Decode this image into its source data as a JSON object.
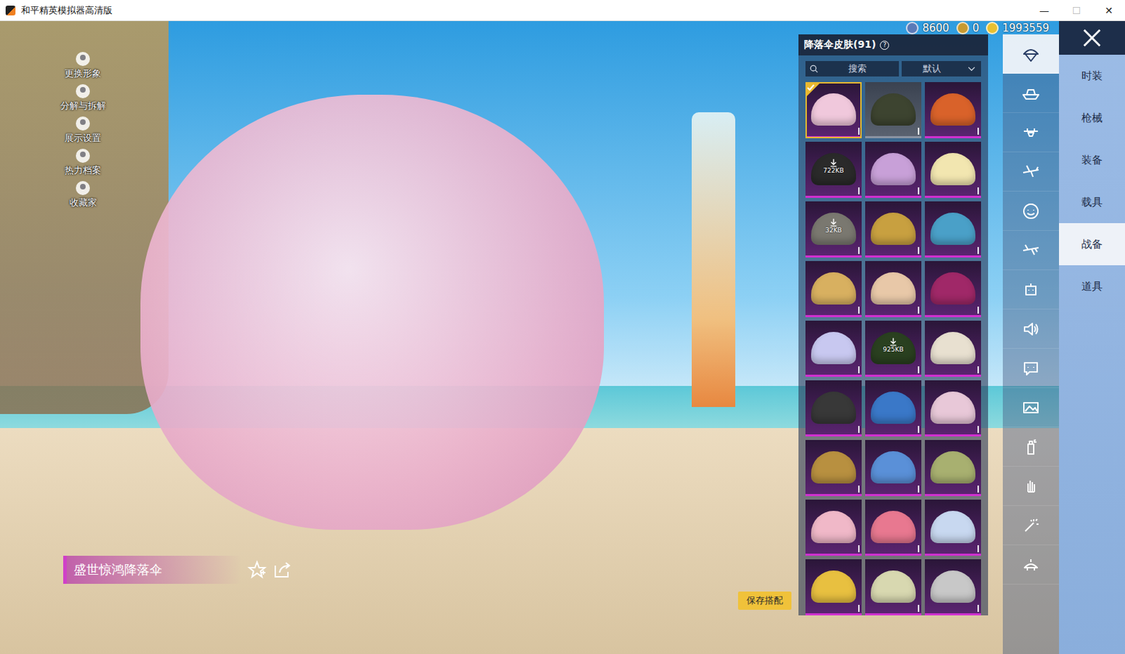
{
  "window": {
    "title": "和平精英模拟器高清版",
    "controls": [
      {
        "glyph": "—",
        "disabled": false
      },
      {
        "glyph": "☐",
        "disabled": true
      },
      {
        "glyph": "✕",
        "disabled": false
      }
    ]
  },
  "side_menu": [
    {
      "label": "更换形象"
    },
    {
      "label": "分解与拆解"
    },
    {
      "label": "展示设置"
    },
    {
      "label": "热力档案"
    },
    {
      "label": "收藏家"
    }
  ],
  "item_name": "盛世惊鸿降落伞",
  "save_button": "保存搭配",
  "currencies": [
    {
      "amount": "8600",
      "color": "#5a7ab8"
    },
    {
      "amount": "0",
      "color": "#c89a30"
    },
    {
      "amount": "1993559",
      "color": "#e8c030"
    }
  ],
  "panel": {
    "title": "降落伞皮肤(91)",
    "help": "?",
    "search_placeholder": "搜索",
    "sort": "默认"
  },
  "skins": [
    {
      "selected": true,
      "rarity": "epic",
      "color": "#f0c8dc"
    },
    {
      "selected": false,
      "rarity": "common",
      "color": "#3d4430"
    },
    {
      "selected": false,
      "rarity": "epic",
      "color": "#d9622a"
    },
    {
      "selected": false,
      "rarity": "epic",
      "color": "#2a2a2a",
      "download": "722KB"
    },
    {
      "selected": false,
      "rarity": "epic",
      "color": "#c8a0d8"
    },
    {
      "selected": false,
      "rarity": "epic",
      "color": "#f2e6b0"
    },
    {
      "selected": false,
      "rarity": "epic",
      "color": "#7a7870",
      "download": "32KB"
    },
    {
      "selected": false,
      "rarity": "epic",
      "color": "#c8a040"
    },
    {
      "selected": false,
      "rarity": "epic",
      "color": "#4aa0c8"
    },
    {
      "selected": false,
      "rarity": "epic",
      "color": "#d8b060"
    },
    {
      "selected": false,
      "rarity": "epic",
      "color": "#e8c8a8"
    },
    {
      "selected": false,
      "rarity": "epic",
      "color": "#a02868"
    },
    {
      "selected": false,
      "rarity": "epic",
      "color": "#c8c8f0"
    },
    {
      "selected": false,
      "rarity": "epic",
      "color": "#2a4020",
      "download": "925KB"
    },
    {
      "selected": false,
      "rarity": "epic",
      "color": "#e8e0d0"
    },
    {
      "selected": false,
      "rarity": "epic",
      "color": "#383838"
    },
    {
      "selected": false,
      "rarity": "epic",
      "color": "#3a78c8"
    },
    {
      "selected": false,
      "rarity": "epic",
      "color": "#e8c8d8"
    },
    {
      "selected": false,
      "rarity": "epic",
      "color": "#b89040"
    },
    {
      "selected": false,
      "rarity": "epic",
      "color": "#5a90d8"
    },
    {
      "selected": false,
      "rarity": "epic",
      "color": "#a8b070"
    },
    {
      "selected": false,
      "rarity": "epic",
      "color": "#f0b8c8"
    },
    {
      "selected": false,
      "rarity": "epic",
      "color": "#e87890"
    },
    {
      "selected": false,
      "rarity": "epic",
      "color": "#c8d8f0"
    },
    {
      "selected": false,
      "rarity": "epic",
      "color": "#e8c040"
    },
    {
      "selected": false,
      "rarity": "epic",
      "color": "#d8d8b0"
    },
    {
      "selected": false,
      "rarity": "epic",
      "color": "#c8c8c8"
    }
  ],
  "categories": [
    {
      "selected": true
    },
    {
      "selected": false
    },
    {
      "selected": false
    },
    {
      "selected": false
    },
    {
      "selected": false
    },
    {
      "selected": false
    },
    {
      "selected": false
    },
    {
      "selected": false
    },
    {
      "selected": false
    },
    {
      "selected": false
    },
    {
      "selected": false
    },
    {
      "selected": false
    },
    {
      "selected": false
    },
    {
      "selected": false
    }
  ],
  "tabs": [
    {
      "label": "时装",
      "selected": false
    },
    {
      "label": "枪械",
      "selected": false
    },
    {
      "label": "装备",
      "selected": false
    },
    {
      "label": "载具",
      "selected": false
    },
    {
      "label": "战备",
      "selected": true
    },
    {
      "label": "道具",
      "selected": false
    }
  ]
}
